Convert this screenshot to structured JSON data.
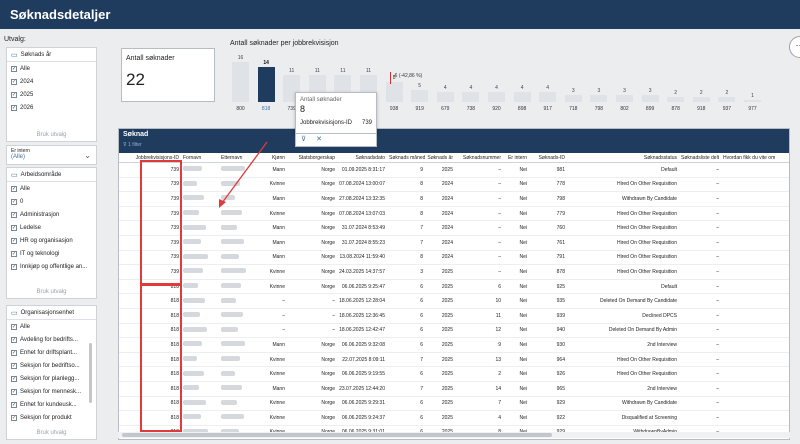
{
  "header": {
    "title": "Søknadsdetaljer"
  },
  "sidebar": {
    "label": "Utvalg:",
    "apply": "Bruk utvalg",
    "years": {
      "title": "Søknads år",
      "items": [
        "Alle",
        "2024",
        "2025",
        "2026"
      ]
    },
    "intern": {
      "label": "Er intern",
      "value": "(Alle)"
    },
    "area": {
      "title": "Arbeidsområde",
      "items": [
        "Alle",
        "0",
        "Administrasjon",
        "Ledelse",
        "HR og organisasjon",
        "IT og teknologi",
        "Innkjøp og offentlige an..."
      ]
    },
    "org": {
      "title": "Organisasjonsenhet",
      "items": [
        "Alle",
        "Avdeling for bedrifts...",
        "Enhet for driftsplant...",
        "Seksjon for bedriftso...",
        "Seksjon for planlegg...",
        "Seksjon for mennesk...",
        "Enhet for kundeusk...",
        "Seksjon for produkt"
      ]
    }
  },
  "kpi": {
    "title": "Antall søknader",
    "value": "22"
  },
  "chart_data": {
    "type": "bar",
    "title": "Antall søknader per jobbrekvisisjon",
    "categories": [
      "800",
      "818",
      "739",
      "",
      "",
      "",
      "938",
      "919",
      "679",
      "738",
      "920",
      "898",
      "917",
      "718",
      "798",
      "802",
      "899",
      "878",
      "918",
      "937",
      "977"
    ],
    "values": [
      16,
      14,
      11,
      11,
      11,
      11,
      8,
      5,
      4,
      4,
      4,
      4,
      4,
      3,
      3,
      3,
      3,
      2,
      2,
      2,
      1
    ],
    "data_labels": [
      "16",
      "14",
      "11",
      "11",
      "11",
      "11",
      "8",
      "5",
      "4",
      "4",
      "4",
      "4",
      "4",
      "3",
      "3",
      "3",
      "3",
      "2",
      "2",
      "2",
      "1"
    ],
    "selected": "818",
    "annotation": "-6 (-42,86 %)"
  },
  "tooltip": {
    "title": "Antall søknader",
    "value": "8",
    "key": "Jobbrekvisisjons-ID",
    "key_value": "739",
    "filter_icon": "⊽",
    "close_icon": "✕"
  },
  "table": {
    "title": "Søknad",
    "subtitle": "1 filter",
    "headers": [
      "Jobbrekvisisjons-ID",
      "Fornavn",
      "Etternavn",
      "Kjønn",
      "Statsborgerskap",
      "Søknadsdato",
      "Søknads måned",
      "Søknads år",
      "Søknadsnummer",
      "Er intern",
      "Søknads-ID",
      "Søknadsstatus",
      "Søknadsliste delt",
      "Hvordan fikk du vite om"
    ],
    "rows": [
      [
        "739",
        "",
        "",
        "Mann",
        "Norge",
        "01.09.2025 8:31:17",
        "9",
        "2025",
        "–",
        "Nei",
        "981",
        "Default",
        "–"
      ],
      [
        "739",
        "",
        "",
        "Kvinne",
        "Norge",
        "07.08.2024 13:00:07",
        "8",
        "2024",
        "–",
        "Nei",
        "778",
        "Hired On Other Requisition",
        "–"
      ],
      [
        "739",
        "",
        "",
        "Mann",
        "Norge",
        "27.08.2024 13:32:35",
        "8",
        "2024",
        "–",
        "Nei",
        "798",
        "Withdrawn By Candidate",
        "–"
      ],
      [
        "739",
        "",
        "",
        "Kvinne",
        "Norge",
        "07.08.2024 13:07:03",
        "8",
        "2024",
        "–",
        "Nei",
        "779",
        "Hired On Other Requisition",
        "–"
      ],
      [
        "739",
        "",
        "",
        "Mann",
        "Norge",
        "31.07.2024 8:53:49",
        "7",
        "2024",
        "–",
        "Nei",
        "760",
        "Hired On Other Requisition",
        "–"
      ],
      [
        "739",
        "",
        "",
        "Mann",
        "Norge",
        "31.07.2024 8:55:23",
        "7",
        "2024",
        "–",
        "Nei",
        "761",
        "Hired On Other Requisition",
        "–"
      ],
      [
        "739",
        "",
        "",
        "Mann",
        "Norge",
        "13.08.2024 11:59:40",
        "8",
        "2024",
        "–",
        "Nei",
        "791",
        "Hired On Other Requisition",
        "–"
      ],
      [
        "739",
        "",
        "",
        "Kvinne",
        "Norge",
        "24.03.2025 14:37:57",
        "3",
        "2025",
        "–",
        "Nei",
        "878",
        "Hired On Other Requisition",
        "–"
      ],
      [
        "818",
        "",
        "",
        "Kvinne",
        "Norge",
        "06.06.2025 9:25:47",
        "6",
        "2025",
        "6",
        "Nei",
        "925",
        "Default",
        "–"
      ],
      [
        "818",
        "",
        "",
        "–",
        "–",
        "18.06.2025 12:28:04",
        "6",
        "2025",
        "10",
        "Nei",
        "935",
        "Deleted On Demand By Candidate",
        "–"
      ],
      [
        "818",
        "",
        "",
        "–",
        "–",
        "18.06.2025 12:36:45",
        "6",
        "2025",
        "11",
        "Nei",
        "939",
        "Declined DPCS",
        "–"
      ],
      [
        "818",
        "",
        "",
        "–",
        "–",
        "18.06.2025 12:42:47",
        "6",
        "2025",
        "12",
        "Nei",
        "940",
        "Deleted On Demand By Admin",
        "–"
      ],
      [
        "818",
        "",
        "",
        "Mann",
        "Norge",
        "06.06.2025 9:32:08",
        "6",
        "2025",
        "9",
        "Nei",
        "930",
        "2nd Interview",
        "–"
      ],
      [
        "818",
        "",
        "",
        "Kvinne",
        "Norge",
        "22.07.2025 8:09:11",
        "7",
        "2025",
        "13",
        "Nei",
        "964",
        "Hired On Other Requisition",
        "–"
      ],
      [
        "818",
        "",
        "",
        "Kvinne",
        "Norge",
        "06.06.2025 9:19:55",
        "6",
        "2025",
        "2",
        "Nei",
        "926",
        "Hired On Other Requisition",
        "–"
      ],
      [
        "818",
        "",
        "",
        "Mann",
        "Norge",
        "23.07.2025 12:44:20",
        "7",
        "2025",
        "14",
        "Nei",
        "965",
        "2nd Interview",
        "–"
      ],
      [
        "818",
        "",
        "",
        "Kvinne",
        "Norge",
        "06.06.2025 9:29:31",
        "6",
        "2025",
        "7",
        "Nei",
        "929",
        "Withdrawn By Candidate",
        "–"
      ],
      [
        "818",
        "",
        "",
        "Kvinne",
        "Norge",
        "06.06.2025 9:24:37",
        "6",
        "2025",
        "4",
        "Nei",
        "922",
        "Disqualified at Screening",
        "–"
      ],
      [
        "818",
        "",
        "",
        "Kvinne",
        "Norge",
        "06.06.2025 9:31:01",
        "6",
        "2025",
        "8",
        "Nei",
        "929",
        "WithdrawnByAdmin",
        "–"
      ]
    ]
  },
  "icons": {
    "more": "more-icon",
    "check": "✓",
    "chevron": "⌄"
  }
}
